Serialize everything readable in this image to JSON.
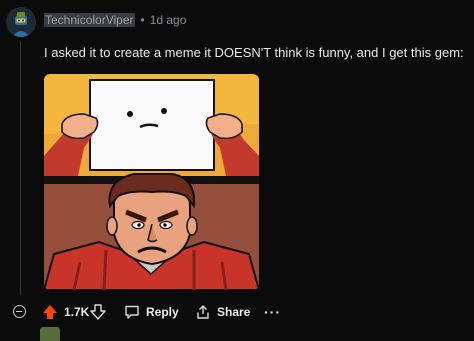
{
  "comment": {
    "author": "TechnicolorViper",
    "separator": "•",
    "time": "1d ago",
    "text": "I asked it to create a meme it DOESN'T think is funny, and I get this gem:"
  },
  "actions": {
    "score": "1.7K",
    "reply_label": "Reply",
    "share_label": "Share",
    "more_label": "···"
  },
  "icons": {
    "avatar": "snoo-avatar-icon",
    "collapse": "collapse-thread-icon",
    "upvote": "upvote-arrow-icon",
    "downvote": "downvote-arrow-icon",
    "reply": "speech-bubble-icon",
    "share": "share-icon",
    "more": "more-options-icon"
  },
  "colors": {
    "background": "#0b0b0b",
    "upvote_active": "#ff4500",
    "meta_text": "#8b8f94"
  }
}
